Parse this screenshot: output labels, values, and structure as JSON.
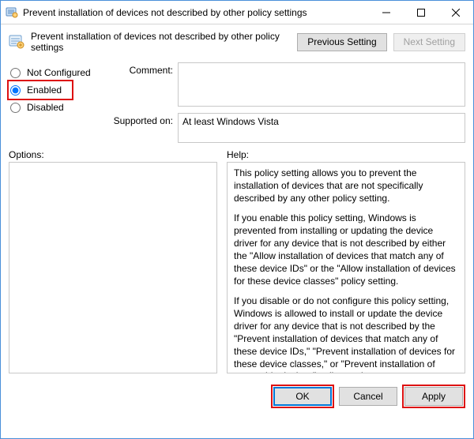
{
  "window": {
    "title": "Prevent installation of devices not described by other policy settings"
  },
  "header": {
    "policy_title": "Prevent installation of devices not described by other policy settings",
    "previous": "Previous Setting",
    "next": "Next Setting"
  },
  "state": {
    "not_configured_label": "Not Configured",
    "enabled_label": "Enabled",
    "disabled_label": "Disabled",
    "selected": "enabled"
  },
  "fields": {
    "comment_label": "Comment:",
    "comment_value": "",
    "supported_label": "Supported on:",
    "supported_value": "At least Windows Vista"
  },
  "labels": {
    "options": "Options:",
    "help": "Help:"
  },
  "help": {
    "p1": "This policy setting allows you to prevent the installation of devices that are not specifically described by any other policy setting.",
    "p2": "If you enable this policy setting, Windows is prevented from installing or updating the device driver for any device that is not described by either the \"Allow installation of devices that match any of these device IDs\" or the \"Allow installation of devices for these device classes\" policy setting.",
    "p3": "If you disable or do not configure this policy setting, Windows is allowed to install or update the device driver for any device that is not described by the \"Prevent installation of devices that match any of these device IDs,\" \"Prevent installation of devices for these device classes,\" or \"Prevent installation of removable devices\" policy setting."
  },
  "footer": {
    "ok": "OK",
    "cancel": "Cancel",
    "apply": "Apply"
  }
}
